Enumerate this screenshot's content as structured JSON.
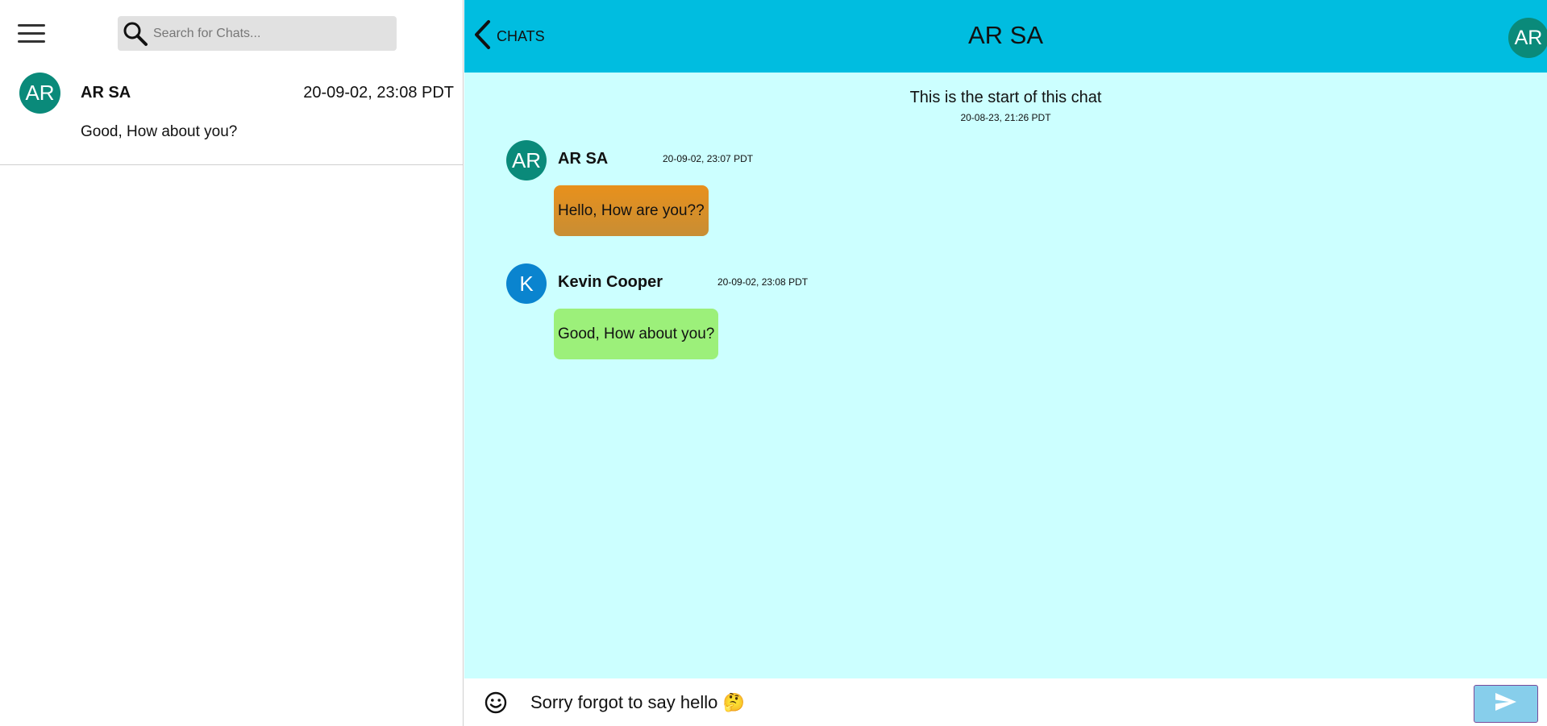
{
  "sidebar": {
    "search": {
      "placeholder": "Search for Chats..."
    },
    "chats": [
      {
        "avatar": "AR",
        "name": "AR SA",
        "time": "20-09-02, 23:08 PDT",
        "preview": "Good, How about you?"
      }
    ]
  },
  "header": {
    "back_label": "CHATS",
    "title": "AR SA",
    "avatar": "AR"
  },
  "conversation": {
    "start_text": "This is the start of this chat",
    "start_time": "20-08-23, 21:26 PDT",
    "messages": [
      {
        "avatar": "AR",
        "sender": "AR SA",
        "time": "20-09-02, 23:07 PDT",
        "text": "Hello, How are you??",
        "bubble_color": "#e0901f"
      },
      {
        "avatar": "K",
        "sender": "Kevin Cooper",
        "time": "20-09-02, 23:08 PDT",
        "text": "Good, How about you?",
        "bubble_color": "#9cf07a"
      }
    ]
  },
  "composer": {
    "value": "Sorry forgot to say hello 🤔"
  },
  "colors": {
    "header": "#00bde0",
    "chat_background": "#ccffff",
    "avatar_teal": "#0a8a7a",
    "avatar_blue": "#0a84cf",
    "send_button": "#87ceeb"
  },
  "icons": [
    "menu-icon",
    "search-icon",
    "chevron-left-icon",
    "emoji-icon",
    "send-icon"
  ]
}
